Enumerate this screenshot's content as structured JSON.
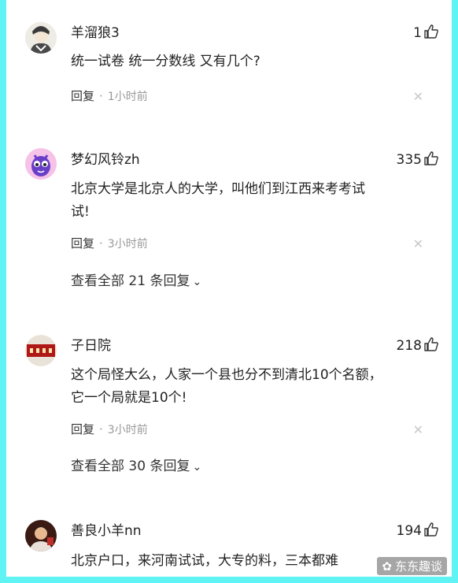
{
  "comments": [
    {
      "username": "羊溜狼3",
      "likes": "1",
      "lines": [
        "统一试卷 统一分数线 又有几个?"
      ],
      "reply_label": "回复",
      "time": "1小时前",
      "avatar": "avatar-ink-portrait"
    },
    {
      "username": "梦幻风铃zh",
      "likes": "335",
      "lines": [
        "北京大学是北京人的大学，叫他们到江西来考考试",
        "试!"
      ],
      "reply_label": "回复",
      "time": "3小时前",
      "view_all": "查看全部 21 条回复",
      "avatar": "avatar-purple-cartoon"
    },
    {
      "username": "子日院",
      "likes": "218",
      "lines": [
        "这个局怪大么，人家一个县也分不到清北10个名额，",
        "它一个局就是10个!"
      ],
      "reply_label": "回复",
      "time": "3小时前",
      "view_all": "查看全部 30 条回复",
      "avatar": "avatar-red-banner"
    },
    {
      "username": "善良小羊nn",
      "likes": "194",
      "lines": [
        "北京户口，来河南试试，大专的料，三本都难"
      ],
      "avatar": "avatar-person-photo"
    }
  ],
  "watermark": "东东趣谈",
  "icons": {
    "like": "thumbs-up-icon",
    "close": "close-icon",
    "chevron": "chevron-down-icon"
  },
  "colors": {
    "frame": "#5ff3f3",
    "text": "#222222",
    "meta": "#999999"
  }
}
